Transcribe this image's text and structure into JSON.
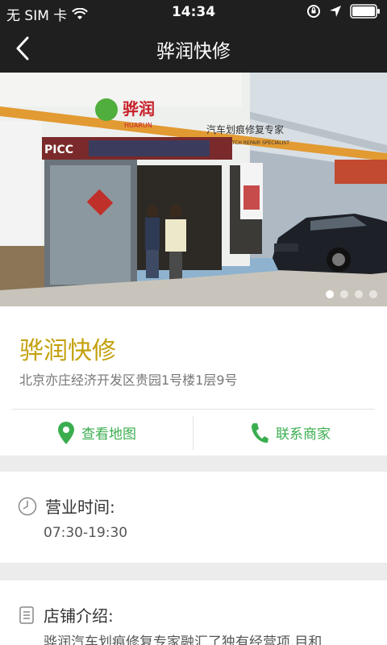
{
  "status_bar": {
    "carrier": "无 SIM 卡",
    "time": "14:34",
    "icons": [
      "wifi-icon",
      "rotation-lock-icon",
      "location-icon",
      "battery-icon"
    ]
  },
  "nav": {
    "title": "骅润快修",
    "back_icon": "chevron-left-icon"
  },
  "banner": {
    "image": "storefront-photo",
    "slide_count": 4,
    "active_slide": 1,
    "signage": {
      "logo_text": "骅润",
      "logo_sub": "HUARUN",
      "sign_cn": "汽车划痕修复专家",
      "sign_en": "CAR SCRATCH REPAIR SPECIALIST",
      "picc": "PICC"
    }
  },
  "shop": {
    "name": "骅润快修",
    "address": "北京亦庄经济开发区贵园1号楼1层9号",
    "map_label": "查看地图",
    "contact_label": "联系商家",
    "map_icon": "map-pin-icon",
    "contact_icon": "phone-icon"
  },
  "hours": {
    "label": "营业时间:",
    "value": "07:30-19:30",
    "icon": "clock-icon"
  },
  "intro": {
    "label": "店铺介绍:",
    "text": "骅润汽车划痕修复专家融汇了独有经营项,目和",
    "icon": "document-icon"
  },
  "colors": {
    "bar_bg": "#1f1f1f",
    "name_gold": "#c4a10c",
    "action_green": "#3aae4f",
    "page_bg": "#ececec"
  }
}
